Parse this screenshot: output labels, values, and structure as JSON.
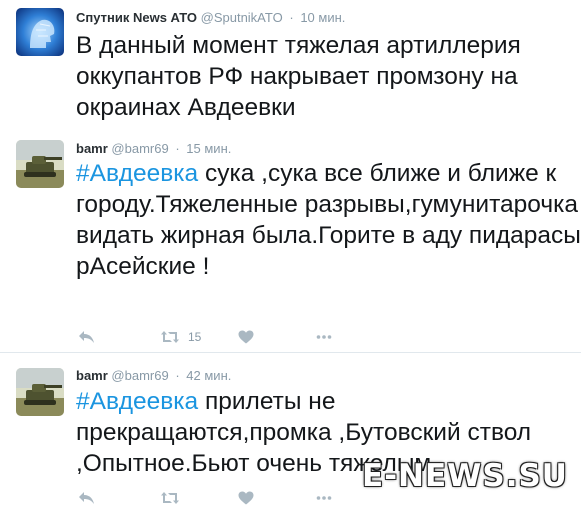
{
  "tweets": [
    {
      "name": "Спутник News АТО",
      "handle": "@SputnikATO",
      "separator": "·",
      "time": "10 мин.",
      "hashtag": "",
      "text": "В данный момент тяжелая артиллерия оккупантов РФ накрывает промзону на окраинах Авдеевки"
    },
    {
      "name": "bamr",
      "handle": "@bamr69",
      "separator": "·",
      "time": "15 мин.",
      "hashtag": "#Авдеевка",
      "text": " сука ,сука все ближе и ближе к городу.Тяжеленные разрывы,гумунитарочка видать жирная была.Горите в аду пидарасы рАсейские !",
      "retweet_count": "15"
    },
    {
      "name": "bamr",
      "handle": "@bamr69",
      "separator": "·",
      "time": "42 мин.",
      "hashtag": "#Авдеевка",
      "text": " прилеты не прекращаются,промка ,Бутовский ствол ,Опытное.Бьют очень тяжелым"
    }
  ],
  "icons": {
    "reply": "reply-icon",
    "retweet": "retweet-icon",
    "like": "heart-icon",
    "more": "more-icon"
  },
  "colors": {
    "hashtag": "#1b95e0",
    "meta": "#8899a6",
    "action_icon": "#aab8c2"
  },
  "watermark": "E-NEWS.SU"
}
